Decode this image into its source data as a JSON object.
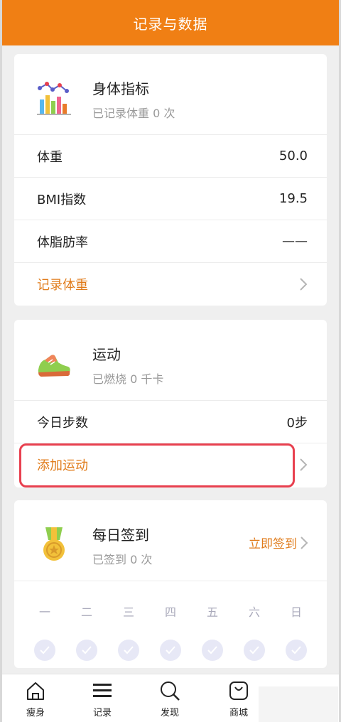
{
  "header": {
    "title": "记录与数据"
  },
  "body_card": {
    "title": "身体指标",
    "subtitle": "已记录体重 0 次",
    "icon": "bar-chart-icon",
    "rows": [
      {
        "label": "体重",
        "value": "50.0"
      },
      {
        "label": "BMI指数",
        "value": "19.5"
      },
      {
        "label": "体脂肪率",
        "value": "——"
      }
    ],
    "action": "记录体重"
  },
  "exercise_card": {
    "title": "运动",
    "subtitle": "已燃烧 0 千卡",
    "icon": "sneaker-icon",
    "steps_label": "今日步数",
    "steps_value": "0步",
    "action": "添加运动"
  },
  "checkin_card": {
    "title": "每日签到",
    "subtitle": "已签到 0 次",
    "icon": "medal-icon",
    "action": "立即签到",
    "days": [
      "一",
      "二",
      "三",
      "四",
      "五",
      "六",
      "日"
    ]
  },
  "tabbar": {
    "tabs": [
      {
        "label": "瘦身",
        "icon": "home-icon"
      },
      {
        "label": "记录",
        "icon": "menu-icon"
      },
      {
        "label": "发现",
        "icon": "search-icon"
      },
      {
        "label": "商城",
        "icon": "shopping-bag-icon"
      }
    ]
  },
  "colors": {
    "accent": "#f07f14",
    "link": "#e07b1a",
    "highlight": "#e8404f"
  }
}
